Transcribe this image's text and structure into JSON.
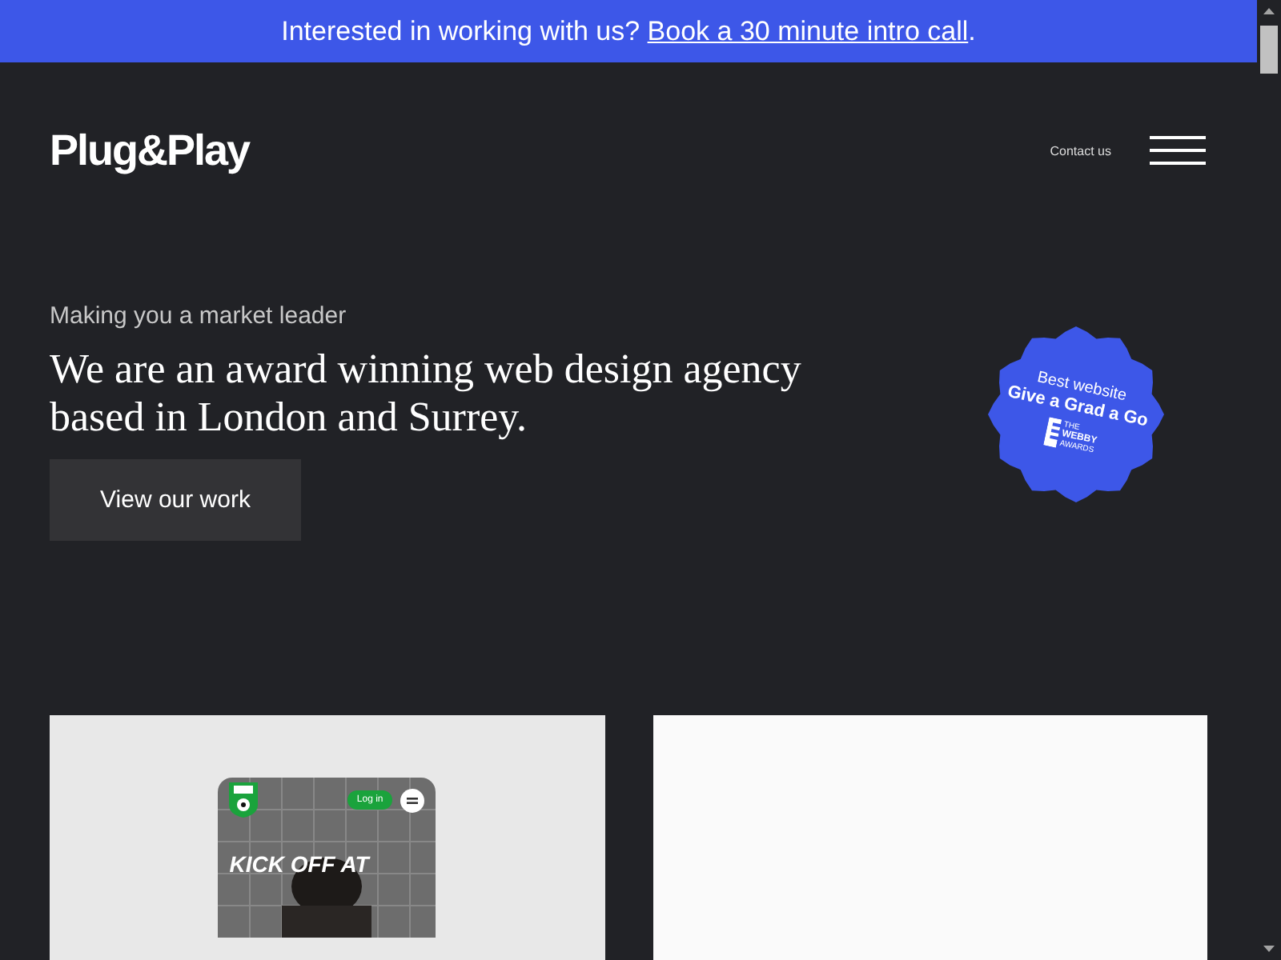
{
  "banner": {
    "text": "Interested in working with us?",
    "link": "Book a 30 minute intro call",
    "end": "."
  },
  "header": {
    "logo": "Plug&Play",
    "contact": "Contact us"
  },
  "hero": {
    "eyebrow": "Making you a market leader",
    "heading": "We are an award winning web design agency based in London and Surrey.",
    "button": "View our work"
  },
  "badge": {
    "line_1": "Best website",
    "line_2": "Give a Grad a Go",
    "award": [
      "THE",
      "WEBBY",
      "AWARDS"
    ]
  },
  "cards": [
    {
      "kind": "phone",
      "login": "Log in",
      "headline": "KICK OFF AT"
    },
    {
      "kind": "blank"
    }
  ]
}
